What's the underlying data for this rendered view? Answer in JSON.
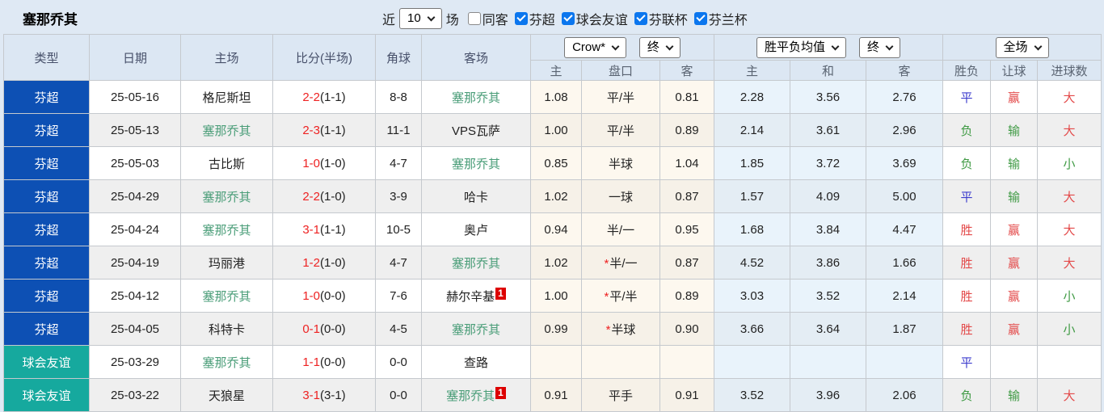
{
  "colors": {
    "type_blue": "#0d50b4",
    "type_teal": "#16a99e",
    "team_highlight_green": "#4a9d78",
    "score_red": "#ee2222",
    "win_red": "#e34a4a",
    "draw_blue": "#3c3ccd",
    "loss_green": "#3f9a44",
    "header_bg": "#dce7f3",
    "checkbox_blue": "#0b76ee",
    "badge_red": "#dd0000"
  },
  "team_header": {
    "team_name": "塞那乔其",
    "recent_label": "近",
    "recent_count": "10",
    "matches_label": "场",
    "filters": [
      {
        "label": "同客",
        "checked": false
      },
      {
        "label": "芬超",
        "checked": true
      },
      {
        "label": "球会友谊",
        "checked": true
      },
      {
        "label": "芬联杯",
        "checked": true
      },
      {
        "label": "芬兰杯",
        "checked": true
      }
    ]
  },
  "table": {
    "columns": [
      "类型",
      "日期",
      "主场",
      "比分(半场)",
      "角球",
      "客场"
    ],
    "odds_group": {
      "bookmaker_select": "Crow*",
      "time_select_1": "终",
      "avg_select": "胜平负均值",
      "time_select_2": "终",
      "scope_select": "全场",
      "sub_headers": [
        "主",
        "盘口",
        "客",
        "主",
        "和",
        "客"
      ],
      "result_headers": [
        "胜负",
        "让球",
        "进球数"
      ]
    },
    "rows": [
      {
        "type": {
          "text": "芬超",
          "color": "blue"
        },
        "date": "25-05-16",
        "home": {
          "text": "格尼斯坦",
          "highlight": false,
          "badge": ""
        },
        "score": "2-2",
        "half": "(1-1)",
        "corners": "8-8",
        "away": {
          "text": "塞那乔其",
          "highlight": true,
          "badge": ""
        },
        "home_odds": "1.08",
        "line_star": false,
        "line": "平/半",
        "away_odds": "0.81",
        "avg": [
          "2.28",
          "3.56",
          "2.76"
        ],
        "result": {
          "text": "平",
          "color": "blue"
        },
        "cover": {
          "text": "赢",
          "color": "red"
        },
        "goals": {
          "text": "大",
          "color": "red"
        }
      },
      {
        "type": {
          "text": "芬超",
          "color": "blue"
        },
        "date": "25-05-13",
        "home": {
          "text": "塞那乔其",
          "highlight": true,
          "badge": ""
        },
        "score": "2-3",
        "half": "(1-1)",
        "corners": "11-1",
        "away": {
          "text": "VPS瓦萨",
          "highlight": false,
          "badge": ""
        },
        "home_odds": "1.00",
        "line_star": false,
        "line": "平/半",
        "away_odds": "0.89",
        "avg": [
          "2.14",
          "3.61",
          "2.96"
        ],
        "result": {
          "text": "负",
          "color": "green"
        },
        "cover": {
          "text": "输",
          "color": "green"
        },
        "goals": {
          "text": "大",
          "color": "red"
        }
      },
      {
        "type": {
          "text": "芬超",
          "color": "blue"
        },
        "date": "25-05-03",
        "home": {
          "text": "古比斯",
          "highlight": false,
          "badge": ""
        },
        "score": "1-0",
        "half": "(1-0)",
        "corners": "4-7",
        "away": {
          "text": "塞那乔其",
          "highlight": true,
          "badge": ""
        },
        "home_odds": "0.85",
        "line_star": false,
        "line": "半球",
        "away_odds": "1.04",
        "avg": [
          "1.85",
          "3.72",
          "3.69"
        ],
        "result": {
          "text": "负",
          "color": "green"
        },
        "cover": {
          "text": "输",
          "color": "green"
        },
        "goals": {
          "text": "小",
          "color": "green"
        }
      },
      {
        "type": {
          "text": "芬超",
          "color": "blue"
        },
        "date": "25-04-29",
        "home": {
          "text": "塞那乔其",
          "highlight": true,
          "badge": ""
        },
        "score": "2-2",
        "half": "(1-0)",
        "corners": "3-9",
        "away": {
          "text": "哈卡",
          "highlight": false,
          "badge": ""
        },
        "home_odds": "1.02",
        "line_star": false,
        "line": "一球",
        "away_odds": "0.87",
        "avg": [
          "1.57",
          "4.09",
          "5.00"
        ],
        "result": {
          "text": "平",
          "color": "blue"
        },
        "cover": {
          "text": "输",
          "color": "green"
        },
        "goals": {
          "text": "大",
          "color": "red"
        }
      },
      {
        "type": {
          "text": "芬超",
          "color": "blue"
        },
        "date": "25-04-24",
        "home": {
          "text": "塞那乔其",
          "highlight": true,
          "badge": ""
        },
        "score": "3-1",
        "half": "(1-1)",
        "corners": "10-5",
        "away": {
          "text": "奥卢",
          "highlight": false,
          "badge": ""
        },
        "home_odds": "0.94",
        "line_star": false,
        "line": "半/一",
        "away_odds": "0.95",
        "avg": [
          "1.68",
          "3.84",
          "4.47"
        ],
        "result": {
          "text": "胜",
          "color": "red"
        },
        "cover": {
          "text": "赢",
          "color": "red"
        },
        "goals": {
          "text": "大",
          "color": "red"
        }
      },
      {
        "type": {
          "text": "芬超",
          "color": "blue"
        },
        "date": "25-04-19",
        "home": {
          "text": "玛丽港",
          "highlight": false,
          "badge": ""
        },
        "score": "1-2",
        "half": "(1-0)",
        "corners": "4-7",
        "away": {
          "text": "塞那乔其",
          "highlight": true,
          "badge": ""
        },
        "home_odds": "1.02",
        "line_star": true,
        "line": "半/一",
        "away_odds": "0.87",
        "avg": [
          "4.52",
          "3.86",
          "1.66"
        ],
        "result": {
          "text": "胜",
          "color": "red"
        },
        "cover": {
          "text": "赢",
          "color": "red"
        },
        "goals": {
          "text": "大",
          "color": "red"
        }
      },
      {
        "type": {
          "text": "芬超",
          "color": "blue"
        },
        "date": "25-04-12",
        "home": {
          "text": "塞那乔其",
          "highlight": true,
          "badge": ""
        },
        "score": "1-0",
        "half": "(0-0)",
        "corners": "7-6",
        "away": {
          "text": "赫尔辛基",
          "highlight": false,
          "badge": "1"
        },
        "home_odds": "1.00",
        "line_star": true,
        "line": "平/半",
        "away_odds": "0.89",
        "avg": [
          "3.03",
          "3.52",
          "2.14"
        ],
        "result": {
          "text": "胜",
          "color": "red"
        },
        "cover": {
          "text": "赢",
          "color": "red"
        },
        "goals": {
          "text": "小",
          "color": "green"
        }
      },
      {
        "type": {
          "text": "芬超",
          "color": "blue"
        },
        "date": "25-04-05",
        "home": {
          "text": "科特卡",
          "highlight": false,
          "badge": ""
        },
        "score": "0-1",
        "half": "(0-0)",
        "corners": "4-5",
        "away": {
          "text": "塞那乔其",
          "highlight": true,
          "badge": ""
        },
        "home_odds": "0.99",
        "line_star": true,
        "line": "半球",
        "away_odds": "0.90",
        "avg": [
          "3.66",
          "3.64",
          "1.87"
        ],
        "result": {
          "text": "胜",
          "color": "red"
        },
        "cover": {
          "text": "赢",
          "color": "red"
        },
        "goals": {
          "text": "小",
          "color": "green"
        }
      },
      {
        "type": {
          "text": "球会友谊",
          "color": "teal"
        },
        "date": "25-03-29",
        "home": {
          "text": "塞那乔其",
          "highlight": true,
          "badge": ""
        },
        "score": "1-1",
        "half": "(0-0)",
        "corners": "0-0",
        "away": {
          "text": "查路",
          "highlight": false,
          "badge": ""
        },
        "home_odds": "",
        "line_star": false,
        "line": "",
        "away_odds": "",
        "avg": [
          "",
          "",
          ""
        ],
        "result": {
          "text": "平",
          "color": "blue"
        },
        "cover": {
          "text": "",
          "color": ""
        },
        "goals": {
          "text": "",
          "color": ""
        }
      },
      {
        "type": {
          "text": "球会友谊",
          "color": "teal"
        },
        "date": "25-03-22",
        "home": {
          "text": "天狼星",
          "highlight": false,
          "badge": ""
        },
        "score": "3-1",
        "half": "(3-1)",
        "corners": "0-0",
        "away": {
          "text": "塞那乔其",
          "highlight": true,
          "badge": "1"
        },
        "home_odds": "0.91",
        "line_star": false,
        "line": "平手",
        "away_odds": "0.91",
        "avg": [
          "3.52",
          "3.96",
          "2.06"
        ],
        "result": {
          "text": "负",
          "color": "green"
        },
        "cover": {
          "text": "输",
          "color": "green"
        },
        "goals": {
          "text": "大",
          "color": "red"
        }
      }
    ]
  }
}
